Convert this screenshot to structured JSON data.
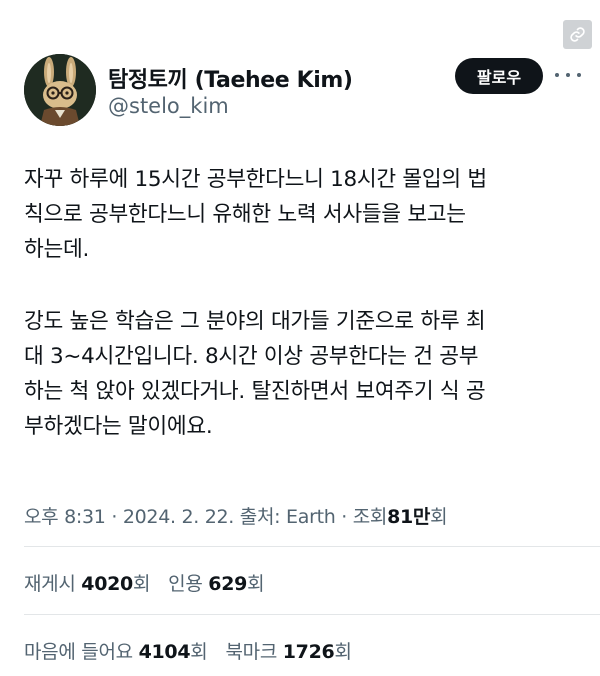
{
  "author": {
    "display_name": "탐정토끼 (Taehee Kim)",
    "handle": "@stelo_kim"
  },
  "actions": {
    "follow_label": "팔로우",
    "more_icon": "more-horizontal-icon",
    "link_icon": "link-icon"
  },
  "post": {
    "paragraphs": [
      [
        "자꾸 하루에 15시간 공부한다느니 18시간 몰입의 법",
        "칙으로 공부한다느니 유해한 노력 서사들을 보고는",
        "하는데."
      ],
      [
        "강도 높은 학습은 그 분야의 대가들 기준으로 하루 최",
        "대 3~4시간입니다. 8시간 이상 공부한다는 건 공부",
        "하는 척 앉아 있겠다거나. 탈진하면서 보여주기 식 공",
        "부하겠다는 말이에요."
      ]
    ]
  },
  "meta": {
    "time": "오후 8:31",
    "separator": "·",
    "date": "2024. 2. 22.",
    "source_label": "출처:",
    "source": "Earth",
    "views_label": "조회",
    "views_count": "81만",
    "views_unit": "회"
  },
  "stats": {
    "reposts_label": "재게시",
    "reposts_count": "4020",
    "quotes_label": "인용",
    "quotes_count": "629",
    "likes_label": "마음에 들어요",
    "likes_count": "4104",
    "bookmarks_label": "북마크",
    "bookmarks_count": "1726",
    "unit": "회"
  },
  "colors": {
    "text": "#0f1419",
    "secondary": "#536471",
    "divider": "#e3e6e8",
    "follow_bg": "#0f1419"
  }
}
